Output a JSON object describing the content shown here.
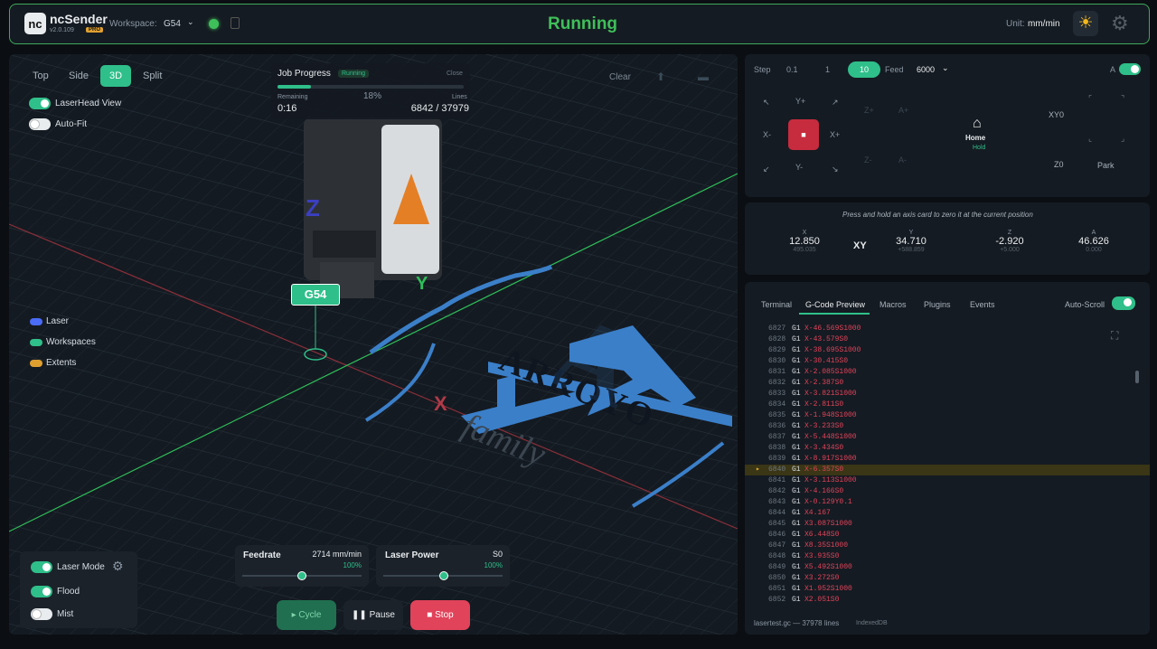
{
  "header": {
    "logo_text": "nc",
    "app_name": "ncSender",
    "version": "v2.0.109",
    "badge": "PRO",
    "workspace_label": "Workspace:",
    "workspace_value": "G54",
    "state": "Running",
    "unit_label": "Unit:",
    "unit_value": "mm/min",
    "colors": {
      "accent": "#2fbf8a",
      "running": "#3fbf5a",
      "stop": "#e0435a"
    }
  },
  "viewport": {
    "views": [
      "Top",
      "Side",
      "3D",
      "Split"
    ],
    "active_view": "3D",
    "toggles": [
      {
        "label": "LaserHead View",
        "on": true
      },
      {
        "label": "Auto-Fit",
        "on": false
      }
    ],
    "legend": [
      {
        "label": "Laser",
        "color": "#4a6cf7"
      },
      {
        "label": "Workspaces",
        "color": "#2fbf8a"
      },
      {
        "label": "Extents",
        "color": "#e0a030"
      }
    ],
    "clear_label": "Clear",
    "wcs_tag": "G54",
    "axis_labels": {
      "x": "X",
      "y": "Y",
      "z": "Z"
    },
    "design_text": {
      "main": "ARROYO",
      "monogram": "A",
      "script": "family"
    },
    "job": {
      "title": "Job Progress",
      "status": "Running",
      "close_label": "Close",
      "progress": 0.18,
      "percent": "18%",
      "remaining_label": "Remaining",
      "remaining": "0:16",
      "lines_label": "Lines",
      "lines": "6842 / 37979"
    },
    "laser_panel": [
      {
        "label": "Laser Mode",
        "on": true
      },
      {
        "label": "Flood",
        "on": true
      },
      {
        "label": "Mist",
        "on": false
      }
    ],
    "feedrate": {
      "label": "Feedrate",
      "value": "2714 mm/min",
      "percent": "100%"
    },
    "laser_power": {
      "label": "Laser Power",
      "value": "S0",
      "percent": "100%"
    },
    "buttons": {
      "cycle": "Cycle",
      "pause": "Pause",
      "stop": "Stop"
    }
  },
  "jog": {
    "step_label": "Step",
    "steps": [
      "0.1",
      "1",
      "10"
    ],
    "active_step": "10",
    "feed_label": "Feed",
    "feed_value": "6000",
    "a_label": "A",
    "xy_labels": {
      "yplus": "Y+",
      "yminus": "Y-",
      "xminus": "X-",
      "xplus": "X+"
    },
    "z_labels": {
      "zplus": "Z+",
      "zminus": "Z-"
    },
    "a_labels": {
      "aplus": "A+",
      "aminus": "A-"
    },
    "home_label": "Home",
    "home_sub": "Hold",
    "xy0_label": "XY0",
    "z0_label": "Z0",
    "park_label": "Park"
  },
  "axes": {
    "hint": "Press and hold an axis card to zero it at the current position",
    "x": {
      "label": "X",
      "value": "12.850",
      "machine": "495.035"
    },
    "xy_label": "XY",
    "y": {
      "label": "Y",
      "value": "34.710",
      "machine": "+588.859"
    },
    "z": {
      "label": "Z",
      "value": "-2.920",
      "machine": "+5.000"
    },
    "a": {
      "label": "A",
      "value": "46.626",
      "machine": "0.000"
    }
  },
  "console": {
    "tabs": [
      "Terminal",
      "G-Code Preview",
      "Macros",
      "Plugins",
      "Events"
    ],
    "active_tab": "G-Code Preview",
    "autoscroll_label": "Auto-Scroll",
    "current_line": "6840",
    "lines": [
      {
        "n": "6827",
        "g": "G1",
        "args": "X-46.569S1000"
      },
      {
        "n": "6828",
        "g": "G1",
        "args": "X-43.579S0"
      },
      {
        "n": "6829",
        "g": "G1",
        "args": "X-38.695S1000"
      },
      {
        "n": "6830",
        "g": "G1",
        "args": "X-30.415S0"
      },
      {
        "n": "6831",
        "g": "G1",
        "args": "X-2.085S1000"
      },
      {
        "n": "6832",
        "g": "G1",
        "args": "X-2.387S0"
      },
      {
        "n": "6833",
        "g": "G1",
        "args": "X-3.821S1000"
      },
      {
        "n": "6834",
        "g": "G1",
        "args": "X-2.811S0"
      },
      {
        "n": "6835",
        "g": "G1",
        "args": "X-1.948S1000"
      },
      {
        "n": "6836",
        "g": "G1",
        "args": "X-3.233S0"
      },
      {
        "n": "6837",
        "g": "G1",
        "args": "X-5.448S1000"
      },
      {
        "n": "6838",
        "g": "G1",
        "args": "X-3.434S0"
      },
      {
        "n": "6839",
        "g": "G1",
        "args": "X-8.917S1000"
      },
      {
        "n": "6840",
        "g": "G1",
        "args": "X-6.357S0"
      },
      {
        "n": "6841",
        "g": "G1",
        "args": "X-3.113S1000"
      },
      {
        "n": "6842",
        "g": "G1",
        "args": "X-4.166S0"
      },
      {
        "n": "6843",
        "g": "G1",
        "args": "X-0.129Y0.1"
      },
      {
        "n": "6844",
        "g": "G1",
        "args": "X4.167"
      },
      {
        "n": "6845",
        "g": "G1",
        "args": "X3.087S1000"
      },
      {
        "n": "6846",
        "g": "G1",
        "args": "X6.448S0"
      },
      {
        "n": "6847",
        "g": "G1",
        "args": "X8.35S1000"
      },
      {
        "n": "6848",
        "g": "G1",
        "args": "X3.935S0"
      },
      {
        "n": "6849",
        "g": "G1",
        "args": "X5.492S1000"
      },
      {
        "n": "6850",
        "g": "G1",
        "args": "X3.272S0"
      },
      {
        "n": "6851",
        "g": "G1",
        "args": "X1.952S1000"
      },
      {
        "n": "6852",
        "g": "G1",
        "args": "X2.051S0"
      }
    ],
    "footer_file": "lasertest.gc — 37978 lines",
    "footer_status": "IndexedDB"
  }
}
